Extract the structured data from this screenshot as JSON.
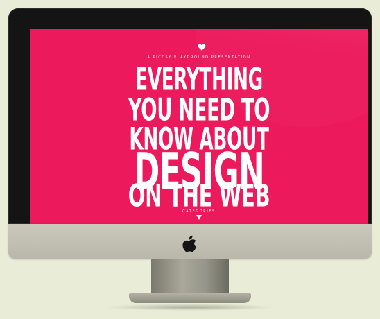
{
  "site": {
    "kicker": "A PICCSY PLAYGROUND PRESENTATION",
    "headline": [
      "EVERYTHING",
      "YOU NEED TO",
      "KNOW ABOUT",
      "DESIGN",
      "ON THE WEB"
    ],
    "categories_label": "CATEGORIES"
  },
  "icons": {
    "top": "heart-icon",
    "below_categories": "triangle-down-icon",
    "monitor_logo": "apple-logo-icon"
  },
  "colors": {
    "screen_background": "#ec1a5c",
    "text": "#ffffff",
    "page_background": "#e9edd7",
    "bezel": "#141414"
  }
}
